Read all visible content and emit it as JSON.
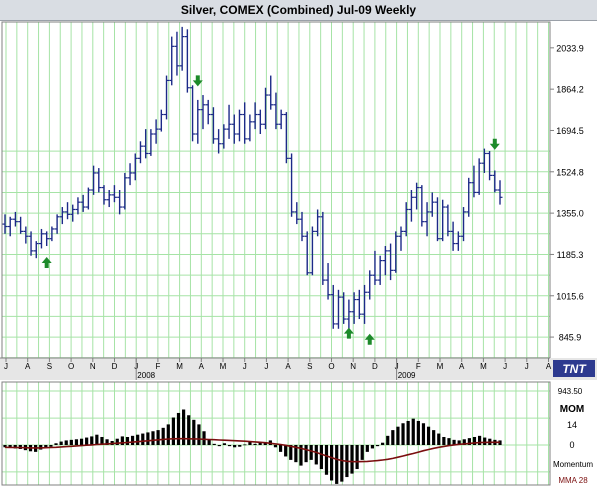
{
  "title": "Silver, COMEX (Combined) Jul-09  Weekly",
  "logo_text": "TNT",
  "colors": {
    "grid": "#a6e3a6",
    "price_bar": "#1c2a88",
    "arrow": "#1d8a2a",
    "histogram": "#000000",
    "ma_line": "#7a0e0e",
    "panel_border": "#808080"
  },
  "chart_data": [
    {
      "type": "bar",
      "subtype": "ohlc",
      "title": "Silver, COMEX (Combined) Jul-09  Weekly",
      "x_tick_labels": [
        "J",
        "A",
        "S",
        "O",
        "N",
        "D",
        "J",
        "F",
        "M",
        "A",
        "M",
        "J",
        "J",
        "A",
        "S",
        "O",
        "N",
        "D",
        "J",
        "F",
        "M",
        "A",
        "M",
        "J",
        "J",
        "A"
      ],
      "year_labels": [
        "2008",
        "2009"
      ],
      "y_tick_labels": [
        "2033.9",
        "1864.2",
        "1694.5",
        "1524.8",
        "1355.0",
        "1185.3",
        "1015.6",
        "845.9"
      ],
      "ylim": [
        760,
        2140
      ],
      "grid": true,
      "bars": [
        [
          1310,
          1350,
          1270,
          1300
        ],
        [
          1300,
          1340,
          1260,
          1330
        ],
        [
          1330,
          1360,
          1300,
          1320
        ],
        [
          1320,
          1340,
          1270,
          1280
        ],
        [
          1280,
          1300,
          1230,
          1260
        ],
        [
          1260,
          1280,
          1180,
          1200
        ],
        [
          1200,
          1240,
          1170,
          1230
        ],
        [
          1230,
          1290,
          1210,
          1270
        ],
        [
          1270,
          1280,
          1220,
          1250
        ],
        [
          1250,
          1300,
          1240,
          1290
        ],
        [
          1290,
          1350,
          1270,
          1340
        ],
        [
          1340,
          1380,
          1310,
          1360
        ],
        [
          1360,
          1400,
          1330,
          1350
        ],
        [
          1350,
          1390,
          1320,
          1370
        ],
        [
          1370,
          1420,
          1350,
          1400
        ],
        [
          1400,
          1430,
          1360,
          1380
        ],
        [
          1380,
          1460,
          1370,
          1450
        ],
        [
          1450,
          1550,
          1430,
          1520
        ],
        [
          1520,
          1540,
          1440,
          1460
        ],
        [
          1460,
          1470,
          1390,
          1410
        ],
        [
          1410,
          1450,
          1380,
          1430
        ],
        [
          1430,
          1470,
          1400,
          1420
        ],
        [
          1420,
          1450,
          1350,
          1380
        ],
        [
          1380,
          1520,
          1370,
          1500
        ],
        [
          1500,
          1560,
          1470,
          1520
        ],
        [
          1520,
          1600,
          1490,
          1580
        ],
        [
          1580,
          1650,
          1560,
          1630
        ],
        [
          1630,
          1700,
          1580,
          1600
        ],
        [
          1600,
          1700,
          1590,
          1680
        ],
        [
          1680,
          1740,
          1640,
          1700
        ],
        [
          1700,
          1780,
          1690,
          1760
        ],
        [
          1760,
          1920,
          1740,
          1900
        ],
        [
          1900,
          2080,
          1880,
          2040
        ],
        [
          2040,
          2100,
          1920,
          1960
        ],
        [
          1960,
          2120,
          1940,
          2080
        ],
        [
          2080,
          2110,
          1850,
          1870
        ],
        [
          1870,
          1880,
          1650,
          1680
        ],
        [
          1680,
          1820,
          1640,
          1780
        ],
        [
          1780,
          1840,
          1700,
          1800
        ],
        [
          1800,
          1820,
          1720,
          1760
        ],
        [
          1760,
          1790,
          1640,
          1660
        ],
        [
          1660,
          1700,
          1600,
          1640
        ],
        [
          1640,
          1720,
          1620,
          1700
        ],
        [
          1700,
          1800,
          1660,
          1720
        ],
        [
          1720,
          1760,
          1640,
          1680
        ],
        [
          1680,
          1780,
          1650,
          1760
        ],
        [
          1760,
          1810,
          1640,
          1660
        ],
        [
          1660,
          1760,
          1650,
          1730
        ],
        [
          1730,
          1810,
          1700,
          1760
        ],
        [
          1760,
          1780,
          1680,
          1720
        ],
        [
          1720,
          1870,
          1700,
          1840
        ],
        [
          1840,
          1920,
          1780,
          1800
        ],
        [
          1800,
          1850,
          1700,
          1720
        ],
        [
          1720,
          1780,
          1700,
          1760
        ],
        [
          1760,
          1770,
          1560,
          1580
        ],
        [
          1580,
          1600,
          1340,
          1360
        ],
        [
          1360,
          1400,
          1310,
          1330
        ],
        [
          1330,
          1360,
          1240,
          1260
        ],
        [
          1260,
          1280,
          1100,
          1110
        ],
        [
          1110,
          1300,
          1100,
          1280
        ],
        [
          1280,
          1370,
          1260,
          1340
        ],
        [
          1340,
          1360,
          1060,
          1080
        ],
        [
          1080,
          1150,
          1000,
          1020
        ],
        [
          1020,
          1060,
          880,
          900
        ],
        [
          900,
          1040,
          880,
          1010
        ],
        [
          1010,
          1030,
          900,
          920
        ],
        [
          920,
          1000,
          880,
          950
        ],
        [
          950,
          1030,
          900,
          1000
        ],
        [
          1000,
          1040,
          920,
          940
        ],
        [
          940,
          1060,
          900,
          1030
        ],
        [
          1030,
          1120,
          1000,
          1100
        ],
        [
          1100,
          1200,
          1060,
          1080
        ],
        [
          1080,
          1180,
          1060,
          1160
        ],
        [
          1160,
          1220,
          1100,
          1200
        ],
        [
          1200,
          1230,
          1080,
          1120
        ],
        [
          1120,
          1280,
          1110,
          1260
        ],
        [
          1260,
          1300,
          1200,
          1280
        ],
        [
          1280,
          1400,
          1260,
          1370
        ],
        [
          1370,
          1450,
          1320,
          1420
        ],
        [
          1420,
          1480,
          1370,
          1460
        ],
        [
          1460,
          1470,
          1300,
          1320
        ],
        [
          1320,
          1400,
          1260,
          1360
        ],
        [
          1360,
          1440,
          1340,
          1400
        ],
        [
          1400,
          1420,
          1240,
          1250
        ],
        [
          1250,
          1410,
          1240,
          1380
        ],
        [
          1380,
          1390,
          1260,
          1280
        ],
        [
          1280,
          1320,
          1200,
          1230
        ],
        [
          1230,
          1280,
          1200,
          1260
        ],
        [
          1260,
          1380,
          1240,
          1360
        ],
        [
          1360,
          1500,
          1340,
          1480
        ],
        [
          1480,
          1550,
          1420,
          1440
        ],
        [
          1440,
          1580,
          1430,
          1560
        ],
        [
          1560,
          1620,
          1520,
          1600
        ],
        [
          1600,
          1610,
          1490,
          1510
        ],
        [
          1510,
          1530,
          1440,
          1450
        ],
        [
          1450,
          1490,
          1390,
          1420
        ]
      ],
      "signal_arrows": [
        {
          "bar": 8,
          "direction": "up",
          "price": 1150
        },
        {
          "bar": 37,
          "direction": "down",
          "price": 1900
        },
        {
          "bar": 66,
          "direction": "up",
          "price": 860
        },
        {
          "bar": 70,
          "direction": "up",
          "price": 835
        },
        {
          "bar": 94,
          "direction": "down",
          "price": 1640
        }
      ]
    },
    {
      "type": "bar",
      "subtype": "momentum-histogram",
      "labels": [
        "943.50",
        "MOM",
        "14",
        "0",
        "Momentum",
        "MMA 28"
      ],
      "ylim": [
        -943.5,
        943.5
      ],
      "zero_line": 0,
      "mom_values": [
        -40,
        -50,
        -60,
        -70,
        -90,
        -110,
        -120,
        -80,
        -40,
        -30,
        30,
        60,
        80,
        90,
        100,
        110,
        130,
        150,
        180,
        140,
        100,
        70,
        110,
        150,
        140,
        160,
        180,
        200,
        220,
        240,
        260,
        300,
        360,
        480,
        560,
        620,
        520,
        440,
        360,
        240,
        100,
        20,
        -20,
        30,
        -20,
        -40,
        -30,
        10,
        60,
        20,
        40,
        50,
        80,
        -40,
        -120,
        -200,
        -260,
        -300,
        -360,
        -300,
        -260,
        -340,
        -420,
        -520,
        -620,
        -680,
        -640,
        -560,
        -500,
        -420,
        -260,
        -120,
        -60,
        -20,
        40,
        160,
        260,
        320,
        380,
        420,
        460,
        420,
        380,
        320,
        260,
        200,
        140,
        120,
        90,
        80,
        100,
        120,
        140,
        160,
        130,
        110,
        90,
        80
      ],
      "mma_values": [
        -40,
        -42,
        -44,
        -46,
        -48,
        -50,
        -50,
        -50,
        -48,
        -44,
        -40,
        -34,
        -28,
        -22,
        -16,
        -10,
        -4,
        2,
        8,
        14,
        20,
        26,
        32,
        38,
        44,
        50,
        58,
        66,
        74,
        82,
        90,
        98,
        104,
        108,
        110,
        110,
        108,
        106,
        104,
        100,
        96,
        92,
        88,
        84,
        80,
        76,
        72,
        66,
        60,
        54,
        48,
        40,
        30,
        20,
        8,
        -6,
        -22,
        -40,
        -60,
        -80,
        -104,
        -130,
        -160,
        -190,
        -220,
        -250,
        -270,
        -285,
        -290,
        -292,
        -290,
        -286,
        -280,
        -272,
        -262,
        -250,
        -234,
        -214,
        -192,
        -170,
        -148,
        -124,
        -100,
        -78,
        -58,
        -40,
        -24,
        -10,
        2,
        12,
        20,
        28,
        36,
        42,
        46,
        48,
        48,
        48
      ]
    }
  ]
}
